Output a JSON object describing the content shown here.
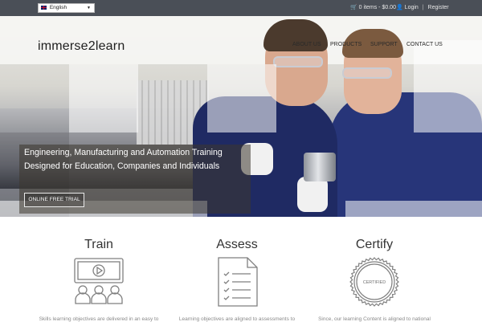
{
  "topbar": {
    "language": "English",
    "cart": "0 items - $0.00",
    "login": "Login",
    "separator": "|",
    "register": "Register"
  },
  "header": {
    "logo": "immerse2learn",
    "nav": [
      "ABOUT US",
      "PRODUCTS",
      "SUPPORT",
      "CONTACT US"
    ]
  },
  "hero": {
    "line1": "Engineering, Manufacturing and Automation Training",
    "line2": "Designed for Education, Companies and Individuals",
    "cta": "ONLINE FREE TRIAL"
  },
  "features": [
    {
      "title": "Train",
      "description": "Skills learning objectives are delivered in an easy to"
    },
    {
      "title": "Assess",
      "description": "Learning objectives are aligned to assessments to"
    },
    {
      "title": "Certify",
      "description": "Since, our learning Content is aligned to national",
      "badge": "CERTIFIED"
    }
  ],
  "colors": {
    "topbar": "#4a4f57",
    "icon_stroke": "#7f7f7f",
    "text_dark": "#333333"
  }
}
